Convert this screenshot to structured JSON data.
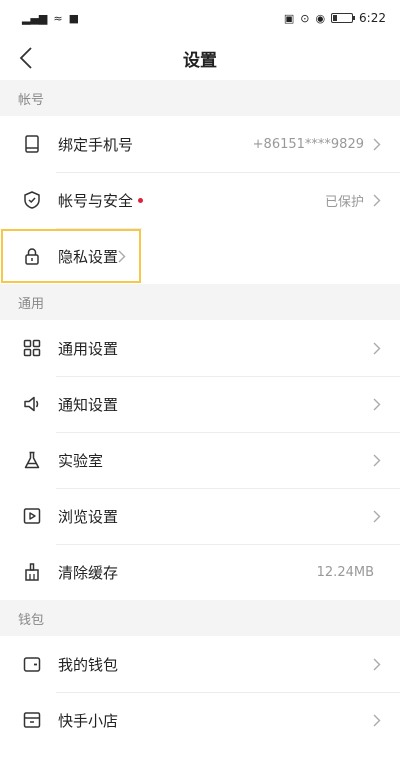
{
  "status_bar": {
    "left_glyphs": "ᴺᴵᴸ ≈ ■",
    "right_glyphs": "▣ ⊙ ◉",
    "time": "6:22",
    "battery_level": 0.2
  },
  "header": {
    "title": "设置",
    "back_icon": "chevron-left-icon"
  },
  "sections": [
    {
      "title": "帐号",
      "items": [
        {
          "icon": "phone-icon",
          "label": "绑定手机号",
          "value": "+86151****9829",
          "chevron": true,
          "dot": false
        },
        {
          "icon": "shield-icon",
          "label": "帐号与安全",
          "value": "已保护",
          "chevron": true,
          "dot": true
        },
        {
          "icon": "lock-icon",
          "label": "隐私设置",
          "value": "",
          "chevron": true,
          "dot": false,
          "highlighted": true
        }
      ]
    },
    {
      "title": "通用",
      "items": [
        {
          "icon": "grid-icon",
          "label": "通用设置",
          "value": "",
          "chevron": true,
          "dot": false
        },
        {
          "icon": "speaker-icon",
          "label": "通知设置",
          "value": "",
          "chevron": true,
          "dot": false
        },
        {
          "icon": "flask-icon",
          "label": "实验室",
          "value": "",
          "chevron": true,
          "dot": false
        },
        {
          "icon": "play-icon",
          "label": "浏览设置",
          "value": "",
          "chevron": true,
          "dot": false
        },
        {
          "icon": "broom-icon",
          "label": "清除缓存",
          "value": "12.24MB",
          "chevron": false,
          "dot": false
        }
      ]
    },
    {
      "title": "钱包",
      "items": [
        {
          "icon": "wallet-icon",
          "label": "我的钱包",
          "value": "",
          "chevron": true,
          "dot": false
        },
        {
          "icon": "shop-icon",
          "label": "快手小店",
          "value": "",
          "chevron": true,
          "dot": false
        }
      ]
    }
  ],
  "colors": {
    "accent_highlight": "#f5c84a",
    "dot": "#e0223a"
  }
}
